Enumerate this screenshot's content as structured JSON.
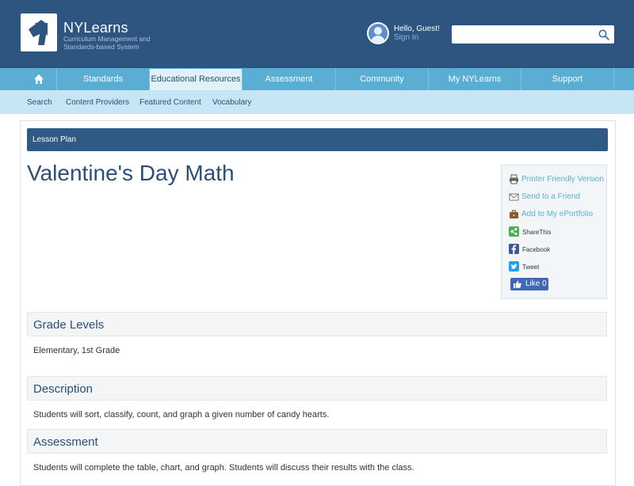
{
  "header": {
    "brand": "NYLearns",
    "tagline": "Curriculum Management and Standards-based System",
    "greeting": "Hello, Guest!",
    "sign_in": "Sign In",
    "search_placeholder": ""
  },
  "nav": {
    "items": [
      "Standards",
      "Educational Resources",
      "Assessment",
      "Community",
      "My NYLearns",
      "Support"
    ],
    "active": "Educational Resources"
  },
  "subnav": {
    "items": [
      "Search",
      "Content Providers",
      "Featured Content",
      "Vocabulary"
    ]
  },
  "page": {
    "type": "Lesson Plan",
    "title": "Valentine's Day Math"
  },
  "share": {
    "printer": "Printer Friendly Version",
    "send": "Send to a Friend",
    "portfolio": "Add to My ePortfolio",
    "sharethis": "ShareThis",
    "facebook": "Facebook",
    "tweet": "Tweet",
    "like": "Like 0"
  },
  "sections": [
    {
      "title": "Grade Levels",
      "body": "Elementary, 1st Grade"
    },
    {
      "title": "Description",
      "body": "Students will sort, classify, count, and graph a given number of candy hearts."
    },
    {
      "title": "Assessment",
      "body": "Students will complete the table, chart, and graph. Students will discuss their results with the class."
    }
  ],
  "colors": {
    "header": "#2d5580",
    "nav": "#5aaed4",
    "subnav": "#c6e6f6",
    "title": "#2d4f74",
    "link": "#5aaed4"
  }
}
